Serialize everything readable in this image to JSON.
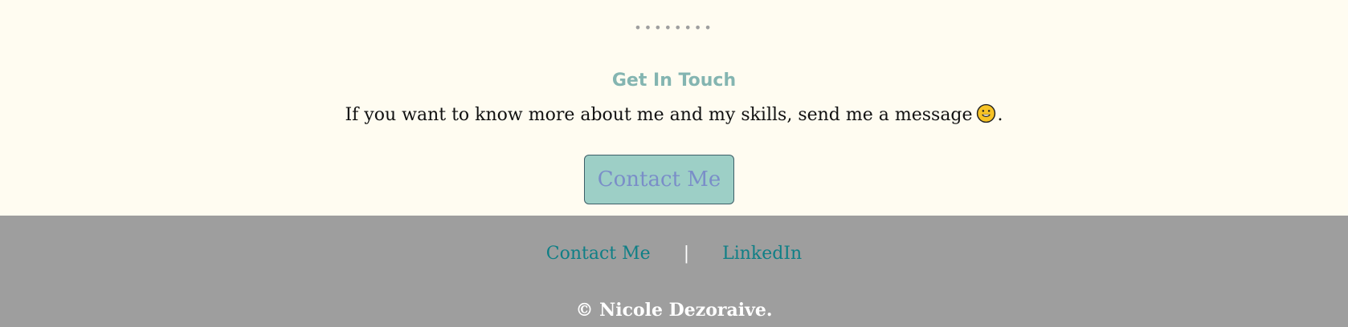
{
  "decoration": {
    "dots": "••••••••"
  },
  "touch": {
    "heading": "Get In Touch",
    "message_before": "If you want to know more about me and my skills, send me a message",
    "message_after": ".",
    "emoji_icon": "smile-icon",
    "button_label": "Contact Me"
  },
  "footer": {
    "links": [
      {
        "label": "Contact Me"
      },
      {
        "label": "LinkedIn"
      }
    ],
    "separator": "|",
    "copyright": "© Nicole Dezoraive."
  },
  "colors": {
    "page_background": "#fffcf1",
    "heading": "#84b5b1",
    "button_background": "#9dcfc6",
    "button_text": "#7a8ec8",
    "footer_background": "#9e9e9e",
    "footer_link": "#0f7f86",
    "footer_text": "#ffffff"
  }
}
